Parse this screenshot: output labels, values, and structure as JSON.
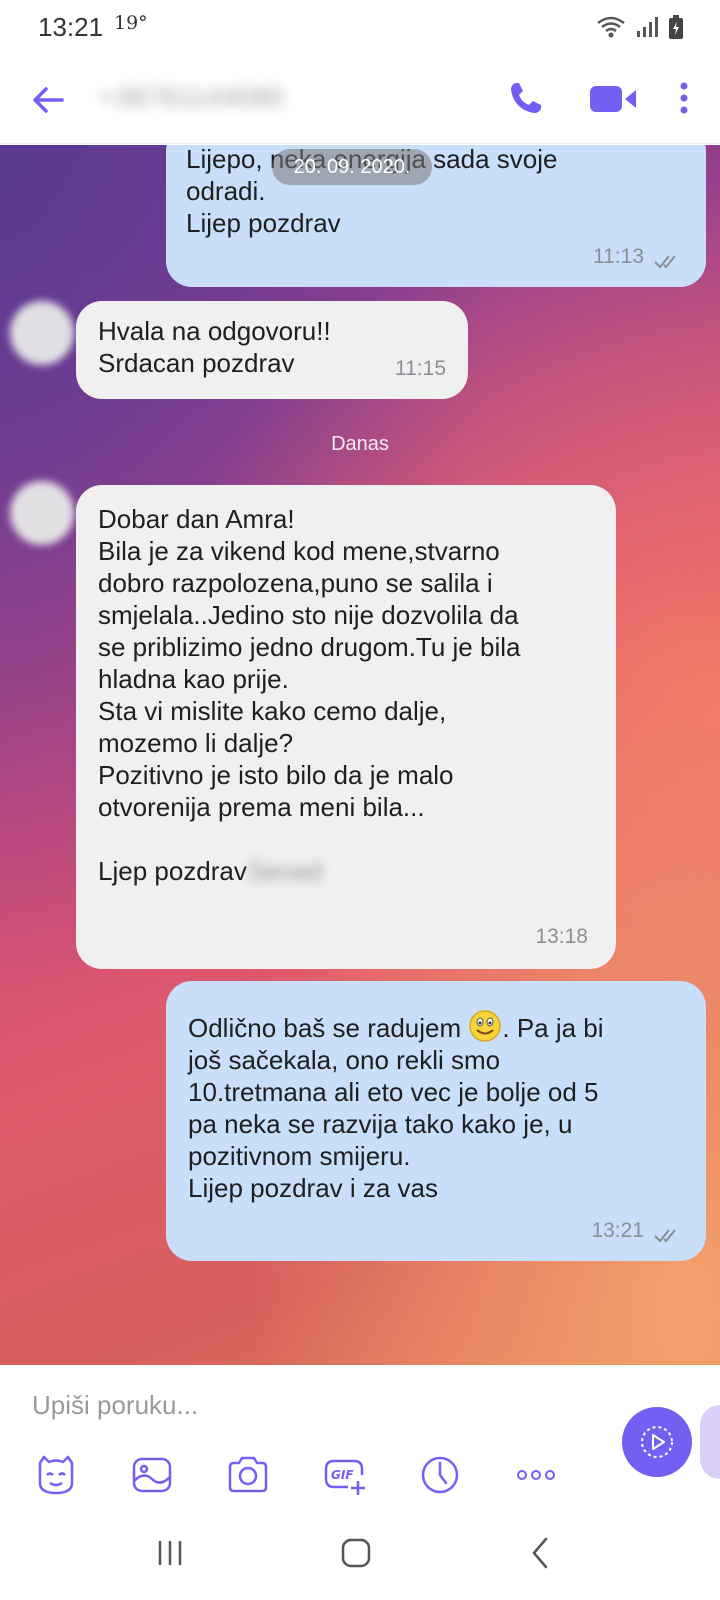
{
  "status_bar": {
    "time": "13:21",
    "temp": "19°"
  },
  "header": {
    "contact_name": "+38761144080"
  },
  "chat": {
    "date_chip": "20. 09. 2020.",
    "day_label": "Danas",
    "messages": [
      {
        "direction": "out",
        "text": "Lijepo, neka energija sada svoje\nodradi.\nLijep pozdrav",
        "time": "11:13"
      },
      {
        "direction": "in",
        "text": "Hvala na odgovoru!!\nSrdacan pozdrav",
        "time": "11:15"
      },
      {
        "direction": "in",
        "text": "Dobar dan Amra!\nBila je za vikend kod mene,stvarno\ndobro razpolozena,puno se salila i\nsmjelala..Jedino sto nije dozvolila da\nse priblizimo jedno drugom.Tu je bila\nhladna kao prije.\nSta vi mislite kako cemo dalje,\nmozemo li dalje?\nPozitivno je isto bilo da je malo\notvorenija prema meni bila...\n\nLjep pozdrav",
        "signature": "Senad",
        "time": "13:18"
      },
      {
        "direction": "out",
        "text_before_emoji": "Odlično baš se radujem",
        "text_after_emoji": ". Pa ja bi",
        "text_rest": "još sačekala, ono rekli smo\n10.tretmana ali eto vec je bolje od 5\npa neka se razvija tako kako je, u\npozitivnom smijeru.\nLijep pozdrav i za vas",
        "time": "13:21"
      }
    ]
  },
  "input_bar": {
    "placeholder": "Upiši poruku...",
    "tools": [
      "sticker-icon",
      "gallery-icon",
      "camera-icon",
      "gif-icon",
      "timer-icon",
      "more-icon"
    ]
  },
  "colors": {
    "accent": "#7360f2",
    "outgoing_bubble": "#c9def9",
    "incoming_bubble": "#f0f0f0"
  }
}
